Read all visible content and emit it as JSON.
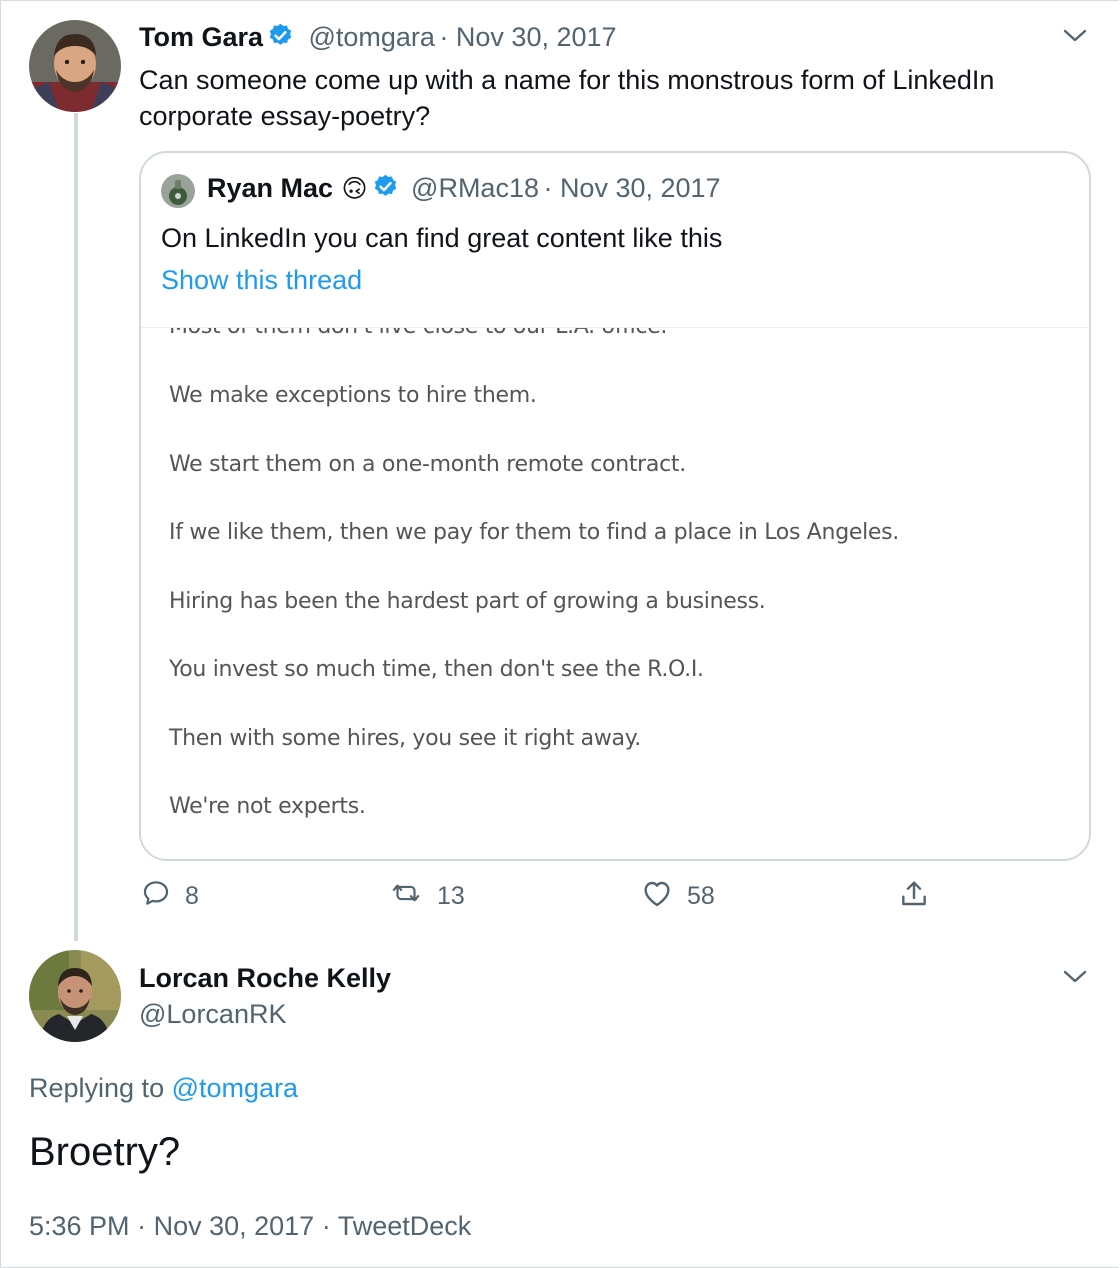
{
  "tweet": {
    "author_name": "Tom Gara",
    "handle": "@tomgara",
    "date": "Nov 30, 2017",
    "text_line1": "Can someone come up with a name for this monstrous form of LinkedIn",
    "text_line2": "corporate essay-poetry?",
    "quote": {
      "author_name": "Ryan Mac",
      "emoji": "🙃",
      "handle": "@RMac18",
      "date": "Nov 30, 2017",
      "text": "On LinkedIn you can find great content like this",
      "show_thread": "Show this thread",
      "image_lines": [
        "Most of them don't live close to our L.A. office.",
        "We make exceptions to hire them.",
        "We start them on a one-month remote contract.",
        "If we like them, then we pay for them to find a place in Los Angeles.",
        "Hiring has been the hardest part of growing a business.",
        "You invest so much time, then don't see the R.O.I.",
        "Then with some hires, you see it right away.",
        "We're not experts."
      ]
    },
    "actions": {
      "replies": "8",
      "retweets": "13",
      "likes": "58"
    }
  },
  "reply": {
    "author_name": "Lorcan Roche Kelly",
    "handle": "@LorcanRK",
    "replying_prefix": "Replying to",
    "replying_to": "@tomgara",
    "text": "Broetry?",
    "time": "5:36 PM",
    "date": "Nov 30, 2017",
    "source": "TweetDeck"
  },
  "colors": {
    "accent": "#1d9bf0",
    "muted": "#536471",
    "border": "#cfd9de"
  }
}
